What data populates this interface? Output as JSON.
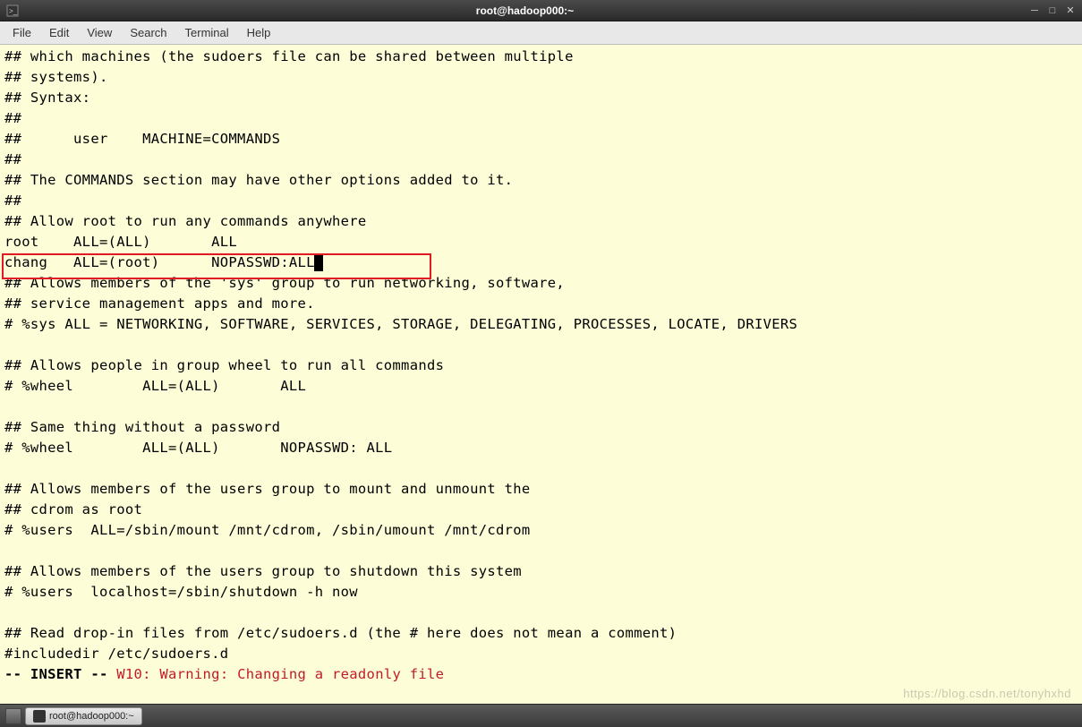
{
  "titlebar": {
    "title": "root@hadoop000:~"
  },
  "menubar": {
    "items": [
      "File",
      "Edit",
      "View",
      "Search",
      "Terminal",
      "Help"
    ]
  },
  "terminal": {
    "lines": [
      "## which machines (the sudoers file can be shared between multiple",
      "## systems).",
      "## Syntax:",
      "##",
      "##      user    MACHINE=COMMANDS",
      "##",
      "## The COMMANDS section may have other options added to it.",
      "##",
      "## Allow root to run any commands anywhere",
      "root    ALL=(ALL)       ALL",
      "chang   ALL=(root)      NOPASSWD:ALL",
      "## Allows members of the 'sys' group to run networking, software,",
      "## service management apps and more.",
      "# %sys ALL = NETWORKING, SOFTWARE, SERVICES, STORAGE, DELEGATING, PROCESSES, LOCATE, DRIVERS",
      "",
      "## Allows people in group wheel to run all commands",
      "# %wheel        ALL=(ALL)       ALL",
      "",
      "## Same thing without a password",
      "# %wheel        ALL=(ALL)       NOPASSWD: ALL",
      "",
      "## Allows members of the users group to mount and unmount the",
      "## cdrom as root",
      "# %users  ALL=/sbin/mount /mnt/cdrom, /sbin/umount /mnt/cdrom",
      "",
      "## Allows members of the users group to shutdown this system",
      "# %users  localhost=/sbin/shutdown -h now",
      "",
      "## Read drop-in files from /etc/sudoers.d (the # here does not mean a comment)",
      "#includedir /etc/sudoers.d"
    ],
    "status_mode": "-- INSERT --",
    "status_warning": "W10: Warning: Changing a readonly file"
  },
  "taskbar": {
    "button_label": "root@hadoop000:~"
  },
  "watermark": "https://blog.csdn.net/tonyhxhd"
}
